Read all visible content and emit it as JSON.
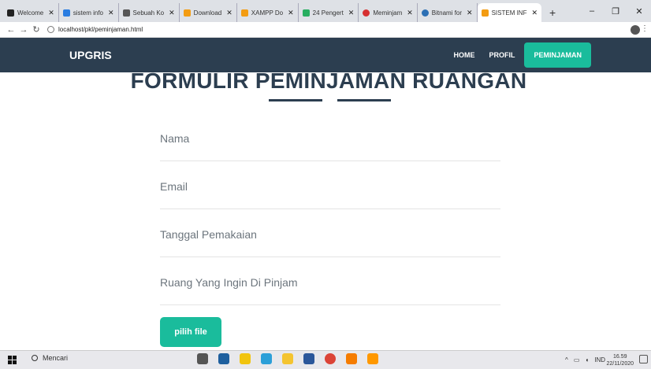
{
  "browser": {
    "tabs": [
      {
        "label": "Welcome",
        "color": "#222222"
      },
      {
        "label": "sistem info",
        "color": "#2a7de1"
      },
      {
        "label": "Sebuah Ko",
        "color": "#555555"
      },
      {
        "label": "Download",
        "color": "#f39c12"
      },
      {
        "label": "XAMPP Do",
        "color": "#f39c12"
      },
      {
        "label": "24 Pengert",
        "color": "#27ae60"
      },
      {
        "label": "Meminjam",
        "color": "#d63031"
      },
      {
        "label": "Bitnami for",
        "color": "#2c6fb4"
      },
      {
        "label": "SISTEM INF",
        "color": "#f39c12"
      }
    ],
    "new_tab": "+",
    "window_controls": [
      "–",
      "❐",
      "✕"
    ],
    "url": "localhost/pkl/peminjaman.html"
  },
  "navbar": {
    "brand": "UPGRIS",
    "links": [
      "HOME",
      "PROFIL"
    ],
    "active_link": "PEMINJAMAN",
    "bg_color": "#2c3e50",
    "accent_color": "#1abc9c"
  },
  "form": {
    "title": "FORMULIR PEMINJAMAN RUANGAN",
    "fields": [
      "Nama",
      "Email",
      "Tanggal Pemakaian",
      "Ruang Yang Ingin Di Pinjam"
    ],
    "file_button": "pilih file"
  },
  "taskbar": {
    "search_placeholder": "Mencari",
    "tray_text": "IND",
    "time": "16.59",
    "date": "22/11/2020"
  }
}
